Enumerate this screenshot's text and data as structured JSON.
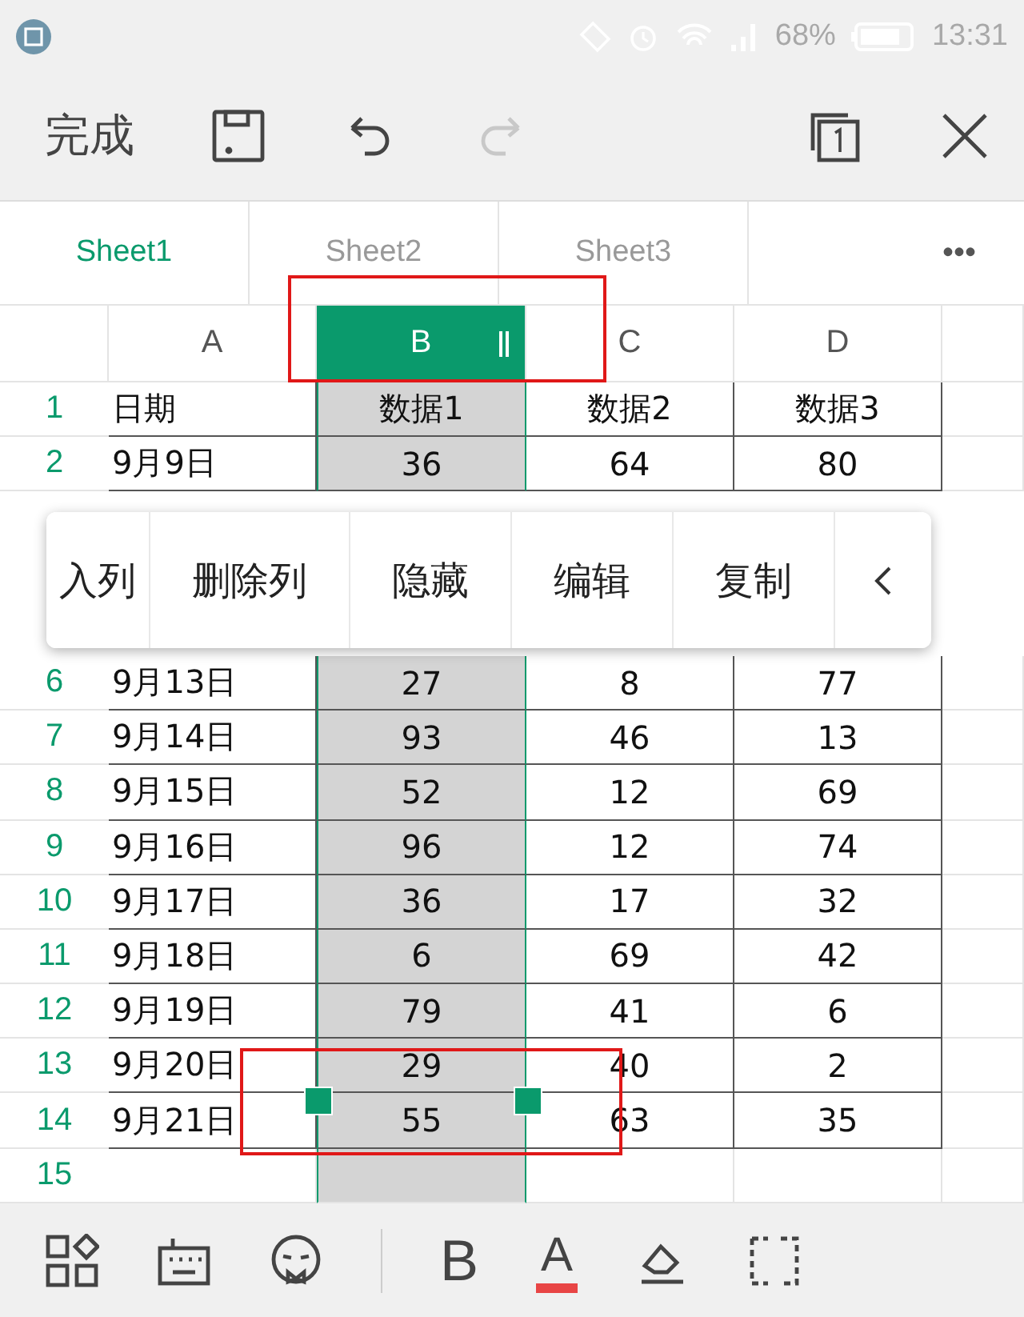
{
  "status_bar": {
    "battery": "68%",
    "time": "13:31"
  },
  "toolbar": {
    "done": "完成",
    "redo_disabled": true
  },
  "sheet_tabs": [
    {
      "label": "Sheet1",
      "selected": true
    },
    {
      "label": "Sheet2",
      "selected": false
    },
    {
      "label": "Sheet3",
      "selected": false
    }
  ],
  "more_tabs": "•••",
  "columns": [
    {
      "label": "A",
      "selected": false
    },
    {
      "label": "B",
      "selected": true
    },
    {
      "label": "C",
      "selected": false
    },
    {
      "label": "D",
      "selected": false
    }
  ],
  "rows": [
    {
      "number": "1",
      "cells": [
        "日期",
        "数据1",
        "数据2",
        "数据3"
      ]
    },
    {
      "number": "2",
      "cells": [
        "9月9日",
        "36",
        "64",
        "80"
      ]
    },
    {
      "number": "6",
      "cells": [
        "9月13日",
        "27",
        "8",
        "77"
      ]
    },
    {
      "number": "7",
      "cells": [
        "9月14日",
        "93",
        "46",
        "13"
      ]
    },
    {
      "number": "8",
      "cells": [
        "9月15日",
        "52",
        "12",
        "69"
      ]
    },
    {
      "number": "9",
      "cells": [
        "9月16日",
        "96",
        "12",
        "74"
      ]
    },
    {
      "number": "10",
      "cells": [
        "9月17日",
        "36",
        "17",
        "32"
      ]
    },
    {
      "number": "11",
      "cells": [
        "9月18日",
        "6",
        "69",
        "42"
      ]
    },
    {
      "number": "12",
      "cells": [
        "9月19日",
        "79",
        "41",
        "6"
      ]
    },
    {
      "number": "13",
      "cells": [
        "9月20日",
        "29",
        "40",
        "2"
      ]
    },
    {
      "number": "14",
      "cells": [
        "9月21日",
        "55",
        "63",
        "35"
      ]
    },
    {
      "number": "15",
      "cells": []
    }
  ],
  "context_menu": [
    "入列",
    "删除列",
    "隐藏",
    "编辑",
    "复制"
  ],
  "bottom_toolbar": {
    "bold": "B",
    "font_color_letter": "A"
  }
}
